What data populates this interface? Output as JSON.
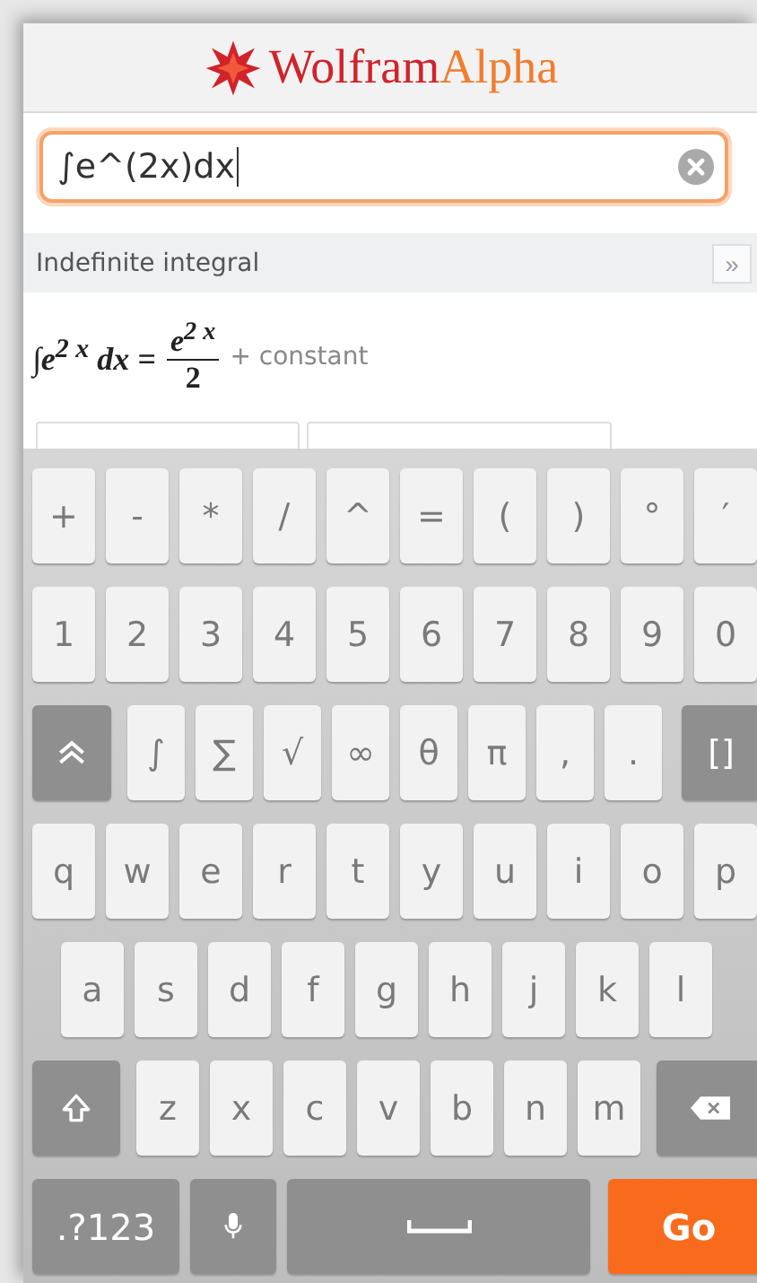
{
  "header": {
    "logo_word_1": "Wolfram",
    "logo_word_2": "Alpha"
  },
  "search": {
    "value": "∫e^(2x)dx",
    "focused": true
  },
  "pod": {
    "title": "Indefinite integral",
    "expand": "»"
  },
  "result": {
    "lhs": "∫e$^{2 x}$ dx =",
    "numerator": "e$^{2 x}$",
    "denominator": "2",
    "suffix": "+ constant"
  },
  "result_buttons": [
    {
      "kind": "button"
    },
    {
      "kind": "button"
    }
  ],
  "keyboard": {
    "rows": [
      [
        {
          "kind": "char",
          "label": "+"
        },
        {
          "kind": "char",
          "label": "-"
        },
        {
          "kind": "char",
          "label": "*"
        },
        {
          "kind": "char",
          "label": "/"
        },
        {
          "kind": "char",
          "label": "^"
        },
        {
          "kind": "char",
          "label": "="
        },
        {
          "kind": "char",
          "label": "("
        },
        {
          "kind": "char",
          "label": ")"
        },
        {
          "kind": "char",
          "label": "°"
        },
        {
          "kind": "char",
          "label": "′"
        }
      ],
      [
        {
          "kind": "char",
          "label": "1"
        },
        {
          "kind": "char",
          "label": "2"
        },
        {
          "kind": "char",
          "label": "3"
        },
        {
          "kind": "char",
          "label": "4"
        },
        {
          "kind": "char",
          "label": "5"
        },
        {
          "kind": "char",
          "label": "6"
        },
        {
          "kind": "char",
          "label": "7"
        },
        {
          "kind": "char",
          "label": "8"
        },
        {
          "kind": "char",
          "label": "9"
        },
        {
          "kind": "char",
          "label": "0"
        }
      ],
      [
        {
          "kind": "more"
        },
        {
          "kind": "char",
          "label": "∫"
        },
        {
          "kind": "char",
          "label": "∑"
        },
        {
          "kind": "char",
          "label": "√"
        },
        {
          "kind": "char",
          "label": "∞"
        },
        {
          "kind": "char",
          "label": "θ"
        },
        {
          "kind": "char",
          "label": "π"
        },
        {
          "kind": "char",
          "label": ","
        },
        {
          "kind": "char",
          "label": "."
        },
        {
          "kind": "func",
          "label": "[]"
        }
      ],
      [
        {
          "kind": "char",
          "label": "q"
        },
        {
          "kind": "char",
          "label": "w"
        },
        {
          "kind": "char",
          "label": "e"
        },
        {
          "kind": "char",
          "label": "r"
        },
        {
          "kind": "char",
          "label": "t"
        },
        {
          "kind": "char",
          "label": "y"
        },
        {
          "kind": "char",
          "label": "u"
        },
        {
          "kind": "char",
          "label": "i"
        },
        {
          "kind": "char",
          "label": "o"
        },
        {
          "kind": "char",
          "label": "p"
        }
      ],
      [
        {
          "kind": "char",
          "label": "a"
        },
        {
          "kind": "char",
          "label": "s"
        },
        {
          "kind": "char",
          "label": "d"
        },
        {
          "kind": "char",
          "label": "f"
        },
        {
          "kind": "char",
          "label": "g"
        },
        {
          "kind": "char",
          "label": "h"
        },
        {
          "kind": "char",
          "label": "j"
        },
        {
          "kind": "char",
          "label": "k"
        },
        {
          "kind": "char",
          "label": "l"
        }
      ],
      [
        {
          "kind": "shift"
        },
        {
          "kind": "char",
          "label": "z"
        },
        {
          "kind": "char",
          "label": "x"
        },
        {
          "kind": "char",
          "label": "c"
        },
        {
          "kind": "char",
          "label": "v"
        },
        {
          "kind": "char",
          "label": "b"
        },
        {
          "kind": "char",
          "label": "n"
        },
        {
          "kind": "char",
          "label": "m"
        },
        {
          "kind": "backspace"
        }
      ],
      [
        {
          "kind": "symbols",
          "label": ".?123"
        },
        {
          "kind": "mic"
        },
        {
          "kind": "space"
        },
        {
          "kind": "go",
          "label": "Go"
        }
      ]
    ]
  }
}
